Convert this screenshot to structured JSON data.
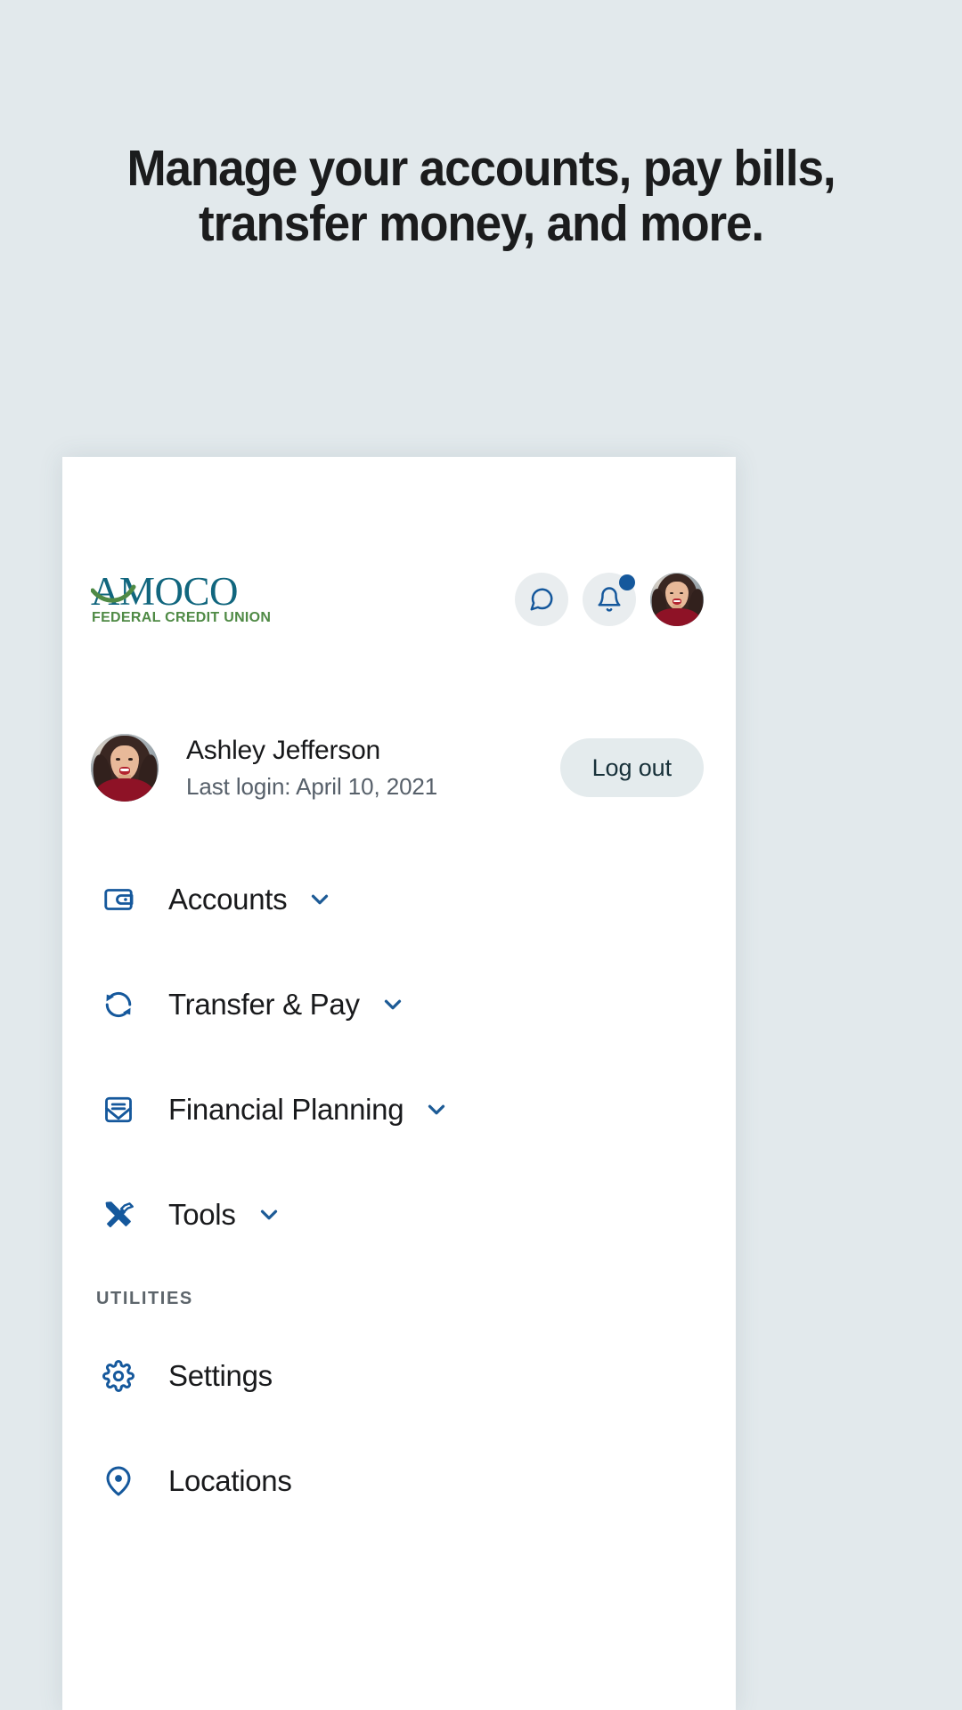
{
  "colors": {
    "page_background": "#e2e9ec",
    "card_background": "#ffffff",
    "headline_text": "#1b1c1d",
    "nav_icon_blue": "#15589c",
    "logo_teal": "#11667e",
    "logo_green": "#4f8a45",
    "badge_blue": "#15589c",
    "logout_pill": "#e4ebed",
    "icon_circle": "#e9edef",
    "section_label": "#5d656b"
  },
  "headline": {
    "line1": "Manage your accounts, pay bills,",
    "line2": "transfer money, and more."
  },
  "card": {
    "logo": {
      "wordmark": "AMOCO",
      "tagline": "FEDERAL CREDIT UNION",
      "swoosh_icon": "swoosh-accent-icon"
    },
    "header_actions": [
      {
        "name": "messages-button",
        "icon": "chat-bubble-icon",
        "has_badge": false
      },
      {
        "name": "notifications-button",
        "icon": "bell-icon",
        "has_badge": true
      },
      {
        "name": "account-avatar-button",
        "icon": "avatar-icon",
        "has_badge": false
      }
    ],
    "profile": {
      "avatar_icon": "avatar-icon",
      "name": "Ashley Jefferson",
      "last_login": "Last login: April 10, 2021",
      "logout_label": "Log out"
    },
    "nav_items": [
      {
        "label": "Accounts",
        "icon": "wallet-icon",
        "chevron": "chevron-down-icon",
        "expandable": true
      },
      {
        "label": "Transfer & Pay",
        "icon": "transfer-arrows-icon",
        "chevron": "chevron-down-icon",
        "expandable": true
      },
      {
        "label": "Financial Planning",
        "icon": "open-envelope-icon",
        "chevron": "chevron-down-icon",
        "expandable": true
      },
      {
        "label": "Tools",
        "icon": "hammer-screwdriver-icon",
        "chevron": "chevron-down-icon",
        "expandable": true
      }
    ],
    "utilities_label": "UTILITIES",
    "utility_items": [
      {
        "label": "Settings",
        "icon": "gear-icon"
      },
      {
        "label": "Locations",
        "icon": "map-pin-icon"
      }
    ]
  }
}
